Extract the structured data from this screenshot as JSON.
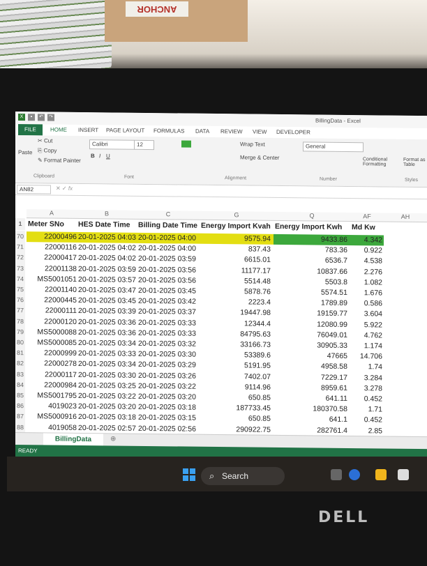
{
  "background": {
    "box_label": "ANCHOR"
  },
  "window": {
    "title": "BillingData - Excel"
  },
  "ribbon_tabs": [
    "FILE",
    "HOME",
    "INSERT",
    "PAGE LAYOUT",
    "FORMULAS",
    "DATA",
    "REVIEW",
    "VIEW",
    "DEVELOPER"
  ],
  "ribbon": {
    "cut": "Cut",
    "copy": "Copy",
    "format_painter": "Format Painter",
    "paste": "Paste",
    "font_name": "Calibri",
    "font_size": "12",
    "wrap_text": "Wrap Text",
    "merge_center": "Merge & Center",
    "number_format": "General",
    "conditional_formatting": "Conditional Formatting",
    "format_table": "Format as Table",
    "groups": {
      "clipboard": "Clipboard",
      "font": "Font",
      "alignment": "Alignment",
      "number": "Number",
      "styles": "Styles"
    }
  },
  "formula_bar": {
    "name_box": "AN82",
    "fx": "fx",
    "value": ""
  },
  "columns": [
    "A",
    "B",
    "C",
    "G",
    "Q",
    "AF",
    "AH"
  ],
  "headers": [
    "Meter SNo",
    "HES Date Time",
    "Billing Date Time",
    "Energy Import Kvah",
    "Energy Import Kwh",
    "Md Kw"
  ],
  "rows": [
    {
      "n": "70",
      "a": "22000496",
      "b": "20-01-2025 04:03",
      "c": "20-01-2025 04:00",
      "g": "9575.94",
      "q": "9433.86",
      "af": "4.342"
    },
    {
      "n": "71",
      "a": "22000116",
      "b": "20-01-2025 04:02",
      "c": "20-01-2025 04:00",
      "g": "837.43",
      "q": "783.36",
      "af": "0.922"
    },
    {
      "n": "72",
      "a": "22000417",
      "b": "20-01-2025 04:02",
      "c": "20-01-2025 03:59",
      "g": "6615.01",
      "q": "6536.7",
      "af": "4.538"
    },
    {
      "n": "73",
      "a": "22001138",
      "b": "20-01-2025 03:59",
      "c": "20-01-2025 03:56",
      "g": "11177.17",
      "q": "10837.66",
      "af": "2.276"
    },
    {
      "n": "74",
      "a": "MS5001051",
      "b": "20-01-2025 03:57",
      "c": "20-01-2025 03:56",
      "g": "5514.48",
      "q": "5503.8",
      "af": "1.082"
    },
    {
      "n": "75",
      "a": "22001140",
      "b": "20-01-2025 03:47",
      "c": "20-01-2025 03:45",
      "g": "5878.76",
      "q": "5574.51",
      "af": "1.676"
    },
    {
      "n": "76",
      "a": "22000445",
      "b": "20-01-2025 03:45",
      "c": "20-01-2025 03:42",
      "g": "2223.4",
      "q": "1789.89",
      "af": "0.586"
    },
    {
      "n": "77",
      "a": "22000111",
      "b": "20-01-2025 03:39",
      "c": "20-01-2025 03:37",
      "g": "19447.98",
      "q": "19159.77",
      "af": "3.604"
    },
    {
      "n": "78",
      "a": "22000120",
      "b": "20-01-2025 03:36",
      "c": "20-01-2025 03:33",
      "g": "12344.4",
      "q": "12080.99",
      "af": "5.922"
    },
    {
      "n": "79",
      "a": "MS5000088",
      "b": "20-01-2025 03:36",
      "c": "20-01-2025 03:33",
      "g": "84795.63",
      "q": "76049.01",
      "af": "4.762"
    },
    {
      "n": "80",
      "a": "MS5000085",
      "b": "20-01-2025 03:34",
      "c": "20-01-2025 03:32",
      "g": "33166.73",
      "q": "30905.33",
      "af": "1.174"
    },
    {
      "n": "81",
      "a": "22000999",
      "b": "20-01-2025 03:33",
      "c": "20-01-2025 03:30",
      "g": "53389.6",
      "q": "47665",
      "af": "14.706"
    },
    {
      "n": "82",
      "a": "22000278",
      "b": "20-01-2025 03:34",
      "c": "20-01-2025 03:29",
      "g": "5191.95",
      "q": "4958.58",
      "af": "1.74"
    },
    {
      "n": "83",
      "a": "22000117",
      "b": "20-01-2025 03:30",
      "c": "20-01-2025 03:26",
      "g": "7402.07",
      "q": "7229.17",
      "af": "3.284"
    },
    {
      "n": "84",
      "a": "22000984",
      "b": "20-01-2025 03:25",
      "c": "20-01-2025 03:22",
      "g": "9114.96",
      "q": "8959.61",
      "af": "3.278"
    },
    {
      "n": "85",
      "a": "MS5001795",
      "b": "20-01-2025 03:22",
      "c": "20-01-2025 03:20",
      "g": "650.85",
      "q": "641.11",
      "af": "0.452"
    },
    {
      "n": "86",
      "a": "4019023",
      "b": "20-01-2025 03:20",
      "c": "20-01-2025 03:18",
      "g": "187733.45",
      "q": "180370.58",
      "af": "1.71"
    },
    {
      "n": "87",
      "a": "MS5000916",
      "b": "20-01-2025 03:18",
      "c": "20-01-2025 03:15",
      "g": "650.85",
      "q": "641.1",
      "af": "0.452"
    },
    {
      "n": "88",
      "a": "4019058",
      "b": "20-01-2025 02:57",
      "c": "20-01-2025 02:56",
      "g": "290922.75",
      "q": "282761.4",
      "af": "2.85"
    }
  ],
  "sheet_tab": "BillingData",
  "status": "READY",
  "taskbar": {
    "search_label": "Search"
  },
  "brand": "DELL",
  "colors": {
    "excel_green": "#217346",
    "highlight_yellow": "#e3de12",
    "highlight_green": "#3ca83c"
  }
}
